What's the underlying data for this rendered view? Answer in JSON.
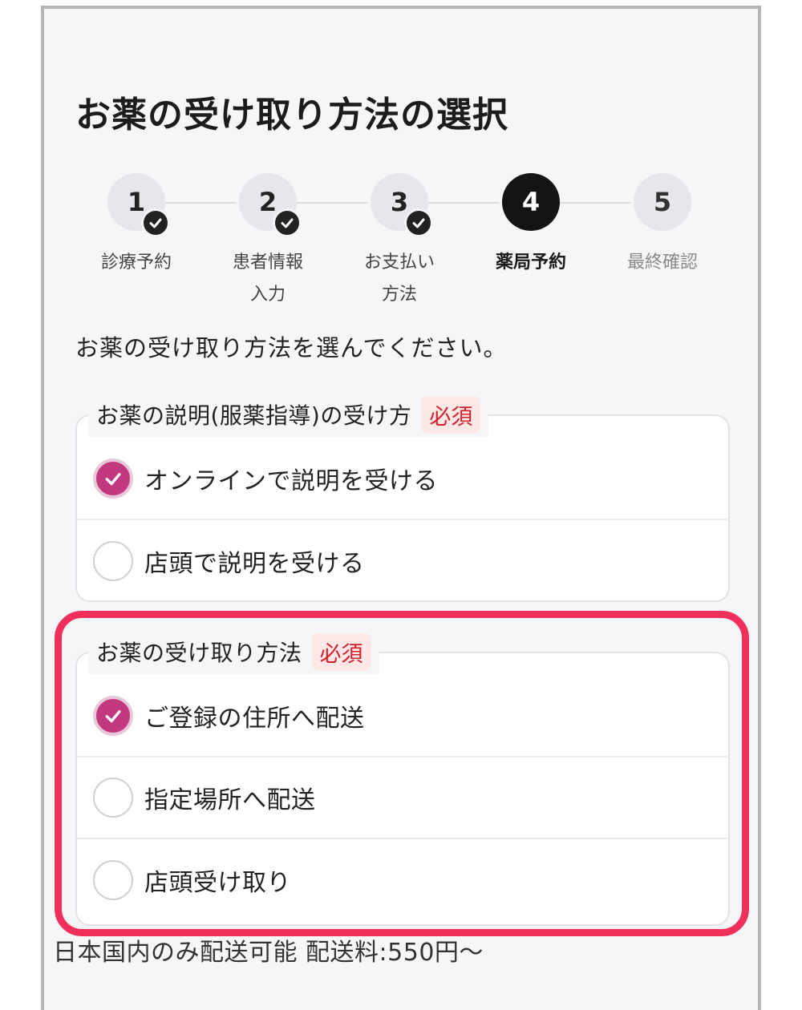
{
  "page": {
    "title": "お薬の受け取り方法の選択",
    "instruction": "お薬の受け取り方法を選んでください。",
    "footnote": "日本国内のみ配送可能 配送料:550円〜"
  },
  "stepper": {
    "steps": [
      {
        "number": "1",
        "label_line1": "診療予約",
        "label_line2": "",
        "status": "completed"
      },
      {
        "number": "2",
        "label_line1": "患者情報",
        "label_line2": "入力",
        "status": "completed"
      },
      {
        "number": "3",
        "label_line1": "お支払い",
        "label_line2": "方法",
        "status": "completed"
      },
      {
        "number": "4",
        "label_line1": "薬局予約",
        "label_line2": "",
        "status": "active"
      },
      {
        "number": "5",
        "label_line1": "最終確認",
        "label_line2": "",
        "status": "pending"
      }
    ]
  },
  "guidance_group": {
    "legend": "お薬の説明(服薬指導)の受け方",
    "required": "必須",
    "options": [
      {
        "label": "オンラインで説明を受ける",
        "selected": true
      },
      {
        "label": "店頭で説明を受ける",
        "selected": false
      }
    ]
  },
  "pickup_group": {
    "legend": "お薬の受け取り方法",
    "required": "必須",
    "options": [
      {
        "label": "ご登録の住所へ配送",
        "selected": true
      },
      {
        "label": "指定場所へ配送",
        "selected": false
      },
      {
        "label": "店頭受け取り",
        "selected": false
      }
    ]
  },
  "colors": {
    "accent": "#c2387f",
    "highlight": "#f0305a",
    "required_text": "#d4202a",
    "active_step": "#141414"
  }
}
